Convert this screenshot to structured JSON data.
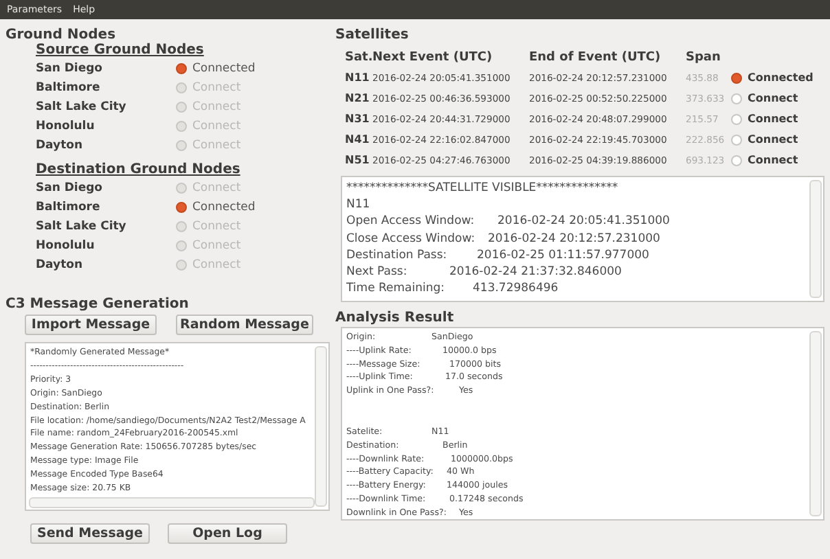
{
  "menu": [
    "Parameters",
    "Help"
  ],
  "ground_nodes": {
    "title": "Ground Nodes",
    "groups": [
      {
        "heading": "Source Ground Nodes",
        "nodes": [
          {
            "name": "San Diego",
            "status": "Connected",
            "selected": true
          },
          {
            "name": "Baltimore",
            "status": "Connect",
            "selected": false
          },
          {
            "name": "Salt Lake City",
            "status": "Connect",
            "selected": false
          },
          {
            "name": "Honolulu",
            "status": "Connect",
            "selected": false
          },
          {
            "name": "Dayton",
            "status": "Connect",
            "selected": false
          }
        ]
      },
      {
        "heading": "Destination Ground Nodes",
        "nodes": [
          {
            "name": "San Diego",
            "status": "Connect",
            "selected": false
          },
          {
            "name": "Baltimore",
            "status": "Connected",
            "selected": true
          },
          {
            "name": "Salt Lake City",
            "status": "Connect",
            "selected": false
          },
          {
            "name": "Honolulu",
            "status": "Connect",
            "selected": false
          },
          {
            "name": "Dayton",
            "status": "Connect",
            "selected": false
          }
        ]
      }
    ]
  },
  "satellites": {
    "title": "Satellites",
    "columns": [
      "Sat.",
      "Next Event (UTC)",
      "End of Event (UTC)",
      "Span"
    ],
    "rows": [
      {
        "sat": "N11",
        "next": "2016-02-24 20:05:41.351000",
        "end": "2016-02-24 20:12:57.231000",
        "span": "435.88",
        "status": "Connected",
        "selected": true
      },
      {
        "sat": "N21",
        "next": "2016-02-25 00:46:36.593000",
        "end": "2016-02-25 00:52:50.225000",
        "span": "373.633",
        "status": "Connect",
        "selected": false
      },
      {
        "sat": "N31",
        "next": "2016-02-24 20:44:31.729000",
        "end": "2016-02-24 20:48:07.299000",
        "span": "215.57",
        "status": "Connect",
        "selected": false
      },
      {
        "sat": "N41",
        "next": "2016-02-24 22:16:02.847000",
        "end": "2016-02-24 22:19:45.703000",
        "span": "222.856",
        "status": "Connect",
        "selected": false
      },
      {
        "sat": "N51",
        "next": "2016-02-25 04:27:46.763000",
        "end": "2016-02-25 04:39:19.886000",
        "span": "693.123",
        "status": "Connect",
        "selected": false
      }
    ],
    "info": [
      {
        "label": "**************SATELLITE VISIBLE**************"
      },
      {
        "label": "N11"
      },
      {
        "label": "Open Access Window:",
        "value": "2016-02-24 20:05:41.351000"
      },
      {
        "label": "Close Access Window:",
        "value": "2016-02-24 20:12:57.231000"
      },
      {
        "label": "Destination Pass:",
        "value": "2016-02-25 01:11:57.977000"
      },
      {
        "label": "Next Pass:",
        "value": "2016-02-24 21:37:32.846000"
      },
      {
        "label": "Time Remaining:",
        "value": "413.72986496"
      }
    ]
  },
  "message": {
    "title": "C3 Message Generation",
    "top_buttons": [
      "Import Message",
      "Random Message"
    ],
    "lines": [
      "*Randomly Generated Message*",
      "--------------------------------------------------",
      "Priority: 3",
      "Origin: SanDiego",
      "Destination: Berlin",
      "File location: /home/sandiego/Documents/N2A2 Test2/Message A",
      "File name: random_24February2016-200545.xml",
      "Message Generation Rate: 150656.707285 bytes/sec",
      "Message type: Image File",
      "Message Encoded Type Base64",
      "Message size: 20.75 KB"
    ],
    "bottom_buttons": [
      "Send Message",
      "Open Log"
    ]
  },
  "analysis": {
    "title": "Analysis Result",
    "blocks": [
      [
        {
          "label": "Origin:",
          "value": "SanDiego"
        },
        {
          "label": "----Uplink Rate:",
          "value": "10000.0 bps"
        },
        {
          "label": "----Message Size:",
          "value": "170000 bits"
        },
        {
          "label": "----Uplink Time:",
          "value": "17.0 seconds"
        },
        {
          "label": "Uplink in One Pass?:",
          "value": "Yes"
        }
      ],
      [
        {
          "label": "Satelite:",
          "value": "N11"
        },
        {
          "label": "Destination:",
          "value": "Berlin"
        },
        {
          "label": "----Downlink Rate:",
          "value": "1000000.0bps"
        },
        {
          "label": "----Battery Capacity:",
          "value": "40 Wh"
        },
        {
          "label": "----Battery Energy:",
          "value": "144000 joules"
        },
        {
          "label": "----Downlink Time:",
          "value": "0.17248 seconds"
        },
        {
          "label": "Downlink in One Pass?:",
          "value": "Yes"
        }
      ]
    ]
  }
}
